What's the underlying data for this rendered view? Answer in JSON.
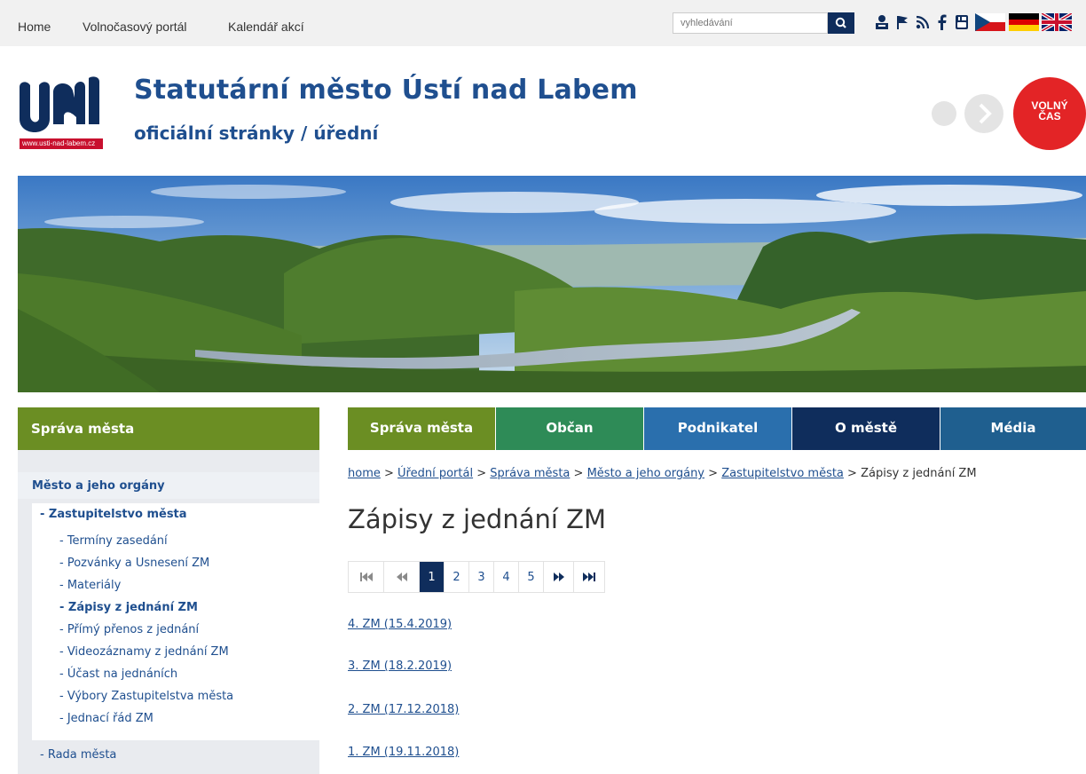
{
  "topnav": [
    "Home",
    "Volnočasový portál",
    "Kalendář akcí"
  ],
  "search": {
    "placeholder": "vyhledávání"
  },
  "header": {
    "title": "Statutární město Ústí nad Labem",
    "subtitle": "oficiální stránky / úřední",
    "logo_caption": "www.usti-nad-labem.cz",
    "badge_line1": "VOLNÝ",
    "badge_line2": "ČAS"
  },
  "social_icons": [
    "user-icon",
    "flag-icon",
    "rss-icon",
    "facebook-icon",
    "youtube-icon",
    "flag-cz-icon",
    "flag-de-icon",
    "flag-gb-icon"
  ],
  "sidebar": {
    "heading": "Správa města",
    "section": "Město a jeho orgány",
    "group": "- Zastupitelstvo města",
    "items": [
      "- Termíny zasedání",
      "- Pozvánky a Usnesení ZM",
      "- Materiály",
      "- Zápisy z jednání ZM",
      "- Přímý přenos z jednání",
      "- Videozáznamy z jednání ZM",
      "- Účast na jednáních",
      "- Výbory Zastupitelstva města",
      "- Jednací řád ZM"
    ],
    "next_group": "- Rada města"
  },
  "tabs": [
    {
      "label": "Správa města",
      "color": "#6b8e23"
    },
    {
      "label": "Občan",
      "color": "#2e8b57"
    },
    {
      "label": "Podnikatel",
      "color": "#2a6fad"
    },
    {
      "label": "O městě",
      "color": "#0f2d5c"
    },
    {
      "label": "Média",
      "color": "#1f5f8f"
    }
  ],
  "breadcrumb": {
    "links": [
      "home",
      "Úřední portál",
      "Správa města",
      "Město a jeho orgány",
      "Zastupitelstvo města"
    ],
    "separator": ">",
    "current": "Zápisy z jednání ZM"
  },
  "page_title": "Zápisy z jednání ZM",
  "pagination": {
    "pages": [
      "1",
      "2",
      "3",
      "4",
      "5"
    ],
    "current": "1"
  },
  "documents": [
    "4. ZM (15.4.2019)",
    "3. ZM (18.2.2019)",
    "2. ZM (17.12.2018)",
    "1. ZM (19.11.2018)"
  ],
  "colors": {
    "navy": "#0f2d5c",
    "brand_blue": "#1f4f8f",
    "olive": "#6b8e23",
    "red": "#e32426"
  }
}
